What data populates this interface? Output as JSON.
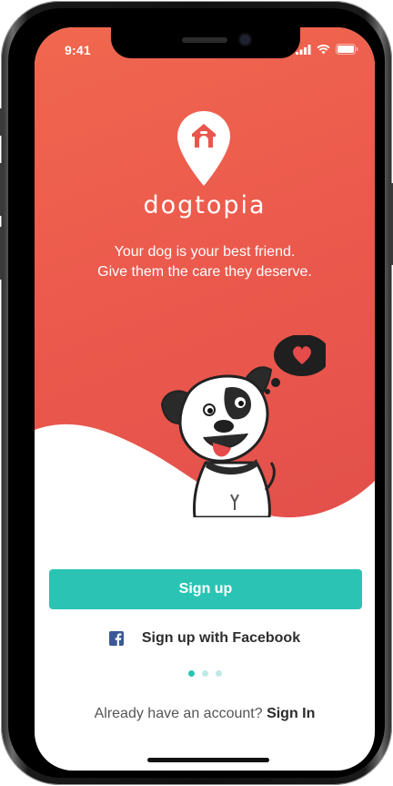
{
  "status_bar": {
    "time": "9:41"
  },
  "app": {
    "brand": "dogtopia",
    "tagline_line1": "Your dog is your best friend.",
    "tagline_line2": "Give them the care they deserve."
  },
  "actions": {
    "signup_label": "Sign up",
    "facebook_label": "Sign up with Facebook"
  },
  "pagination": {
    "total": 3,
    "active": 1
  },
  "footer": {
    "account_prompt": "Already have an account?",
    "signin_label": "Sign In"
  },
  "colors": {
    "hero_start": "#f0674e",
    "hero_end": "#e24f4b",
    "accent": "#2bc4b4",
    "facebook": "#3b5998"
  },
  "icons": [
    "logo-pin-icon",
    "doghouse-icon",
    "heart-icon",
    "facebook-icon",
    "signal-icon",
    "wifi-icon",
    "battery-icon"
  ]
}
